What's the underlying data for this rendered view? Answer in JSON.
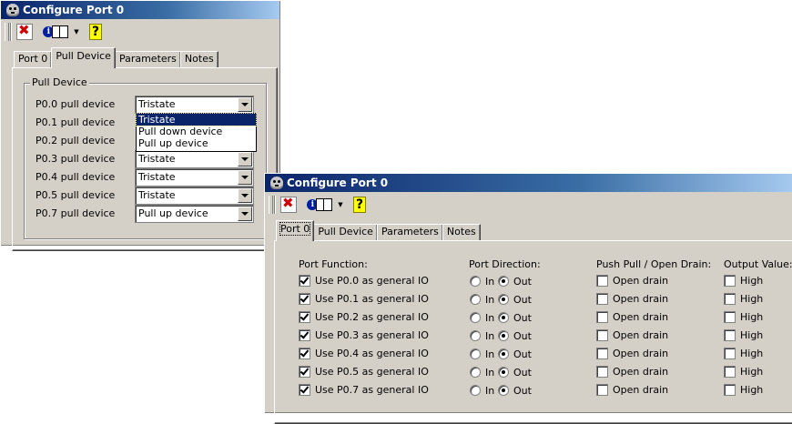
{
  "window1": {
    "title": "Configure Port 0",
    "tabs": [
      "Port 0",
      "Pull Device",
      "Parameters",
      "Notes"
    ],
    "active_tab": "Pull Device",
    "group_label": "Pull Device",
    "rows": [
      {
        "label": "P0.0 pull device",
        "value": "Tristate"
      },
      {
        "label": "P0.1 pull device",
        "value": ""
      },
      {
        "label": "P0.2 pull device",
        "value": ""
      },
      {
        "label": "P0.3 pull device",
        "value": "Tristate"
      },
      {
        "label": "P0.4 pull device",
        "value": "Tristate"
      },
      {
        "label": "P0.5 pull device",
        "value": "Tristate"
      },
      {
        "label": "P0.7 pull device",
        "value": "Pull up device"
      }
    ],
    "dropdown_options": [
      "Tristate",
      "Pull down device",
      "Pull up device"
    ],
    "dropdown_selected": "Tristate"
  },
  "window2": {
    "title": "Configure Port 0",
    "tabs": [
      "Port 0",
      "Pull Device",
      "Parameters",
      "Notes"
    ],
    "active_tab": "Port 0",
    "headers": {
      "function": "Port Function:",
      "direction": "Port Direction:",
      "drive": "Push Pull / Open Drain:",
      "output": "Output Value:"
    },
    "rows": [
      {
        "function": "Use P0.0 as general IO",
        "use": true,
        "in": "In",
        "out": "Out",
        "dir": "out",
        "drain": "Open drain",
        "drain_checked": false,
        "value": "High",
        "value_checked": false
      },
      {
        "function": "Use P0.1 as general IO",
        "use": true,
        "in": "In",
        "out": "Out",
        "dir": "out",
        "drain": "Open drain",
        "drain_checked": false,
        "value": "High",
        "value_checked": false
      },
      {
        "function": "Use P0.2 as general IO",
        "use": true,
        "in": "In",
        "out": "Out",
        "dir": "out",
        "drain": "Open drain",
        "drain_checked": false,
        "value": "High",
        "value_checked": false
      },
      {
        "function": "Use P0.3 as general IO",
        "use": true,
        "in": "In",
        "out": "Out",
        "dir": "out",
        "drain": "Open drain",
        "drain_checked": false,
        "value": "High",
        "value_checked": false
      },
      {
        "function": "Use P0.4 as general IO",
        "use": true,
        "in": "In",
        "out": "Out",
        "dir": "out",
        "drain": "Open drain",
        "drain_checked": false,
        "value": "High",
        "value_checked": false
      },
      {
        "function": "Use P0.5 as general IO",
        "use": true,
        "in": "In",
        "out": "Out",
        "dir": "out",
        "drain": "Open drain",
        "drain_checked": false,
        "value": "High",
        "value_checked": false
      },
      {
        "function": "Use P0.7 as general IO",
        "use": true,
        "in": "In",
        "out": "Out",
        "dir": "out",
        "drain": "Open drain",
        "drain_checked": false,
        "value": "High",
        "value_checked": false
      }
    ]
  },
  "toolbar": {
    "close_icon": "close-x-icon",
    "info_icon": "info-book-icon",
    "help_icon": "help-question-icon",
    "help_glyph": "?"
  }
}
